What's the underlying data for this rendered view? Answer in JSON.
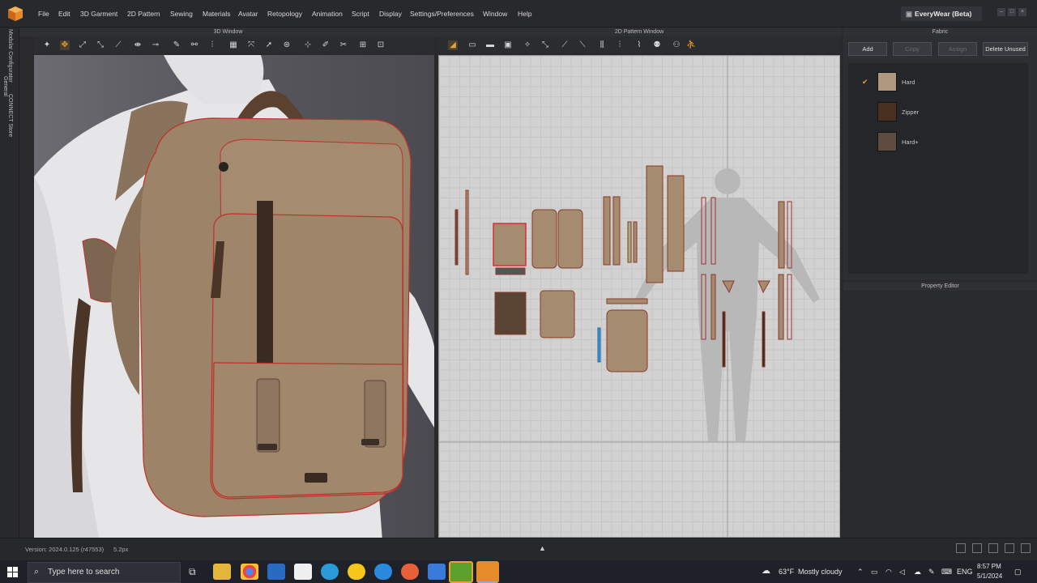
{
  "menubar": {
    "items": [
      "File",
      "Edit",
      "3D Garment",
      "2D Pattern",
      "Sewing",
      "Materials",
      "Avatar",
      "Retopology",
      "Animation",
      "Script",
      "Display",
      "Settings/Preferences",
      "Window",
      "Help"
    ],
    "brand": "EveryWear (Beta)"
  },
  "left_tabs": [
    "Modular Configurator",
    "General",
    "CONNECT Store"
  ],
  "panels": {
    "window3d_title": "3D Window",
    "pattern_title": "2D Pattern Window",
    "fabric_title": "Fabric",
    "property_title": "Property Editor"
  },
  "fabric": {
    "buttons": [
      "Add",
      "Copy",
      "Assign",
      "Delete Unused"
    ],
    "items": [
      {
        "name": "Hard",
        "color": "#b09880",
        "selected": true
      },
      {
        "name": "Zipper",
        "color": "#4a3020",
        "selected": false
      },
      {
        "name": "Hard+",
        "color": "#5d4c3f",
        "selected": false
      }
    ],
    "check_mark": "✔"
  },
  "status": {
    "version": "Version: 2024.0.125 (r47553)",
    "zoom": "5.2px"
  },
  "taskbar": {
    "search_placeholder": "Type here to search",
    "weather_temp": "63°F",
    "weather_text": "Mostly cloudy",
    "lang": "ENG",
    "time": "8:57 PM",
    "date": "5/1/2024"
  },
  "colors": {
    "accent": "#e8a13a",
    "backpack": "#9d8368",
    "seam": "#c0302b",
    "strap": "#4a3526"
  }
}
